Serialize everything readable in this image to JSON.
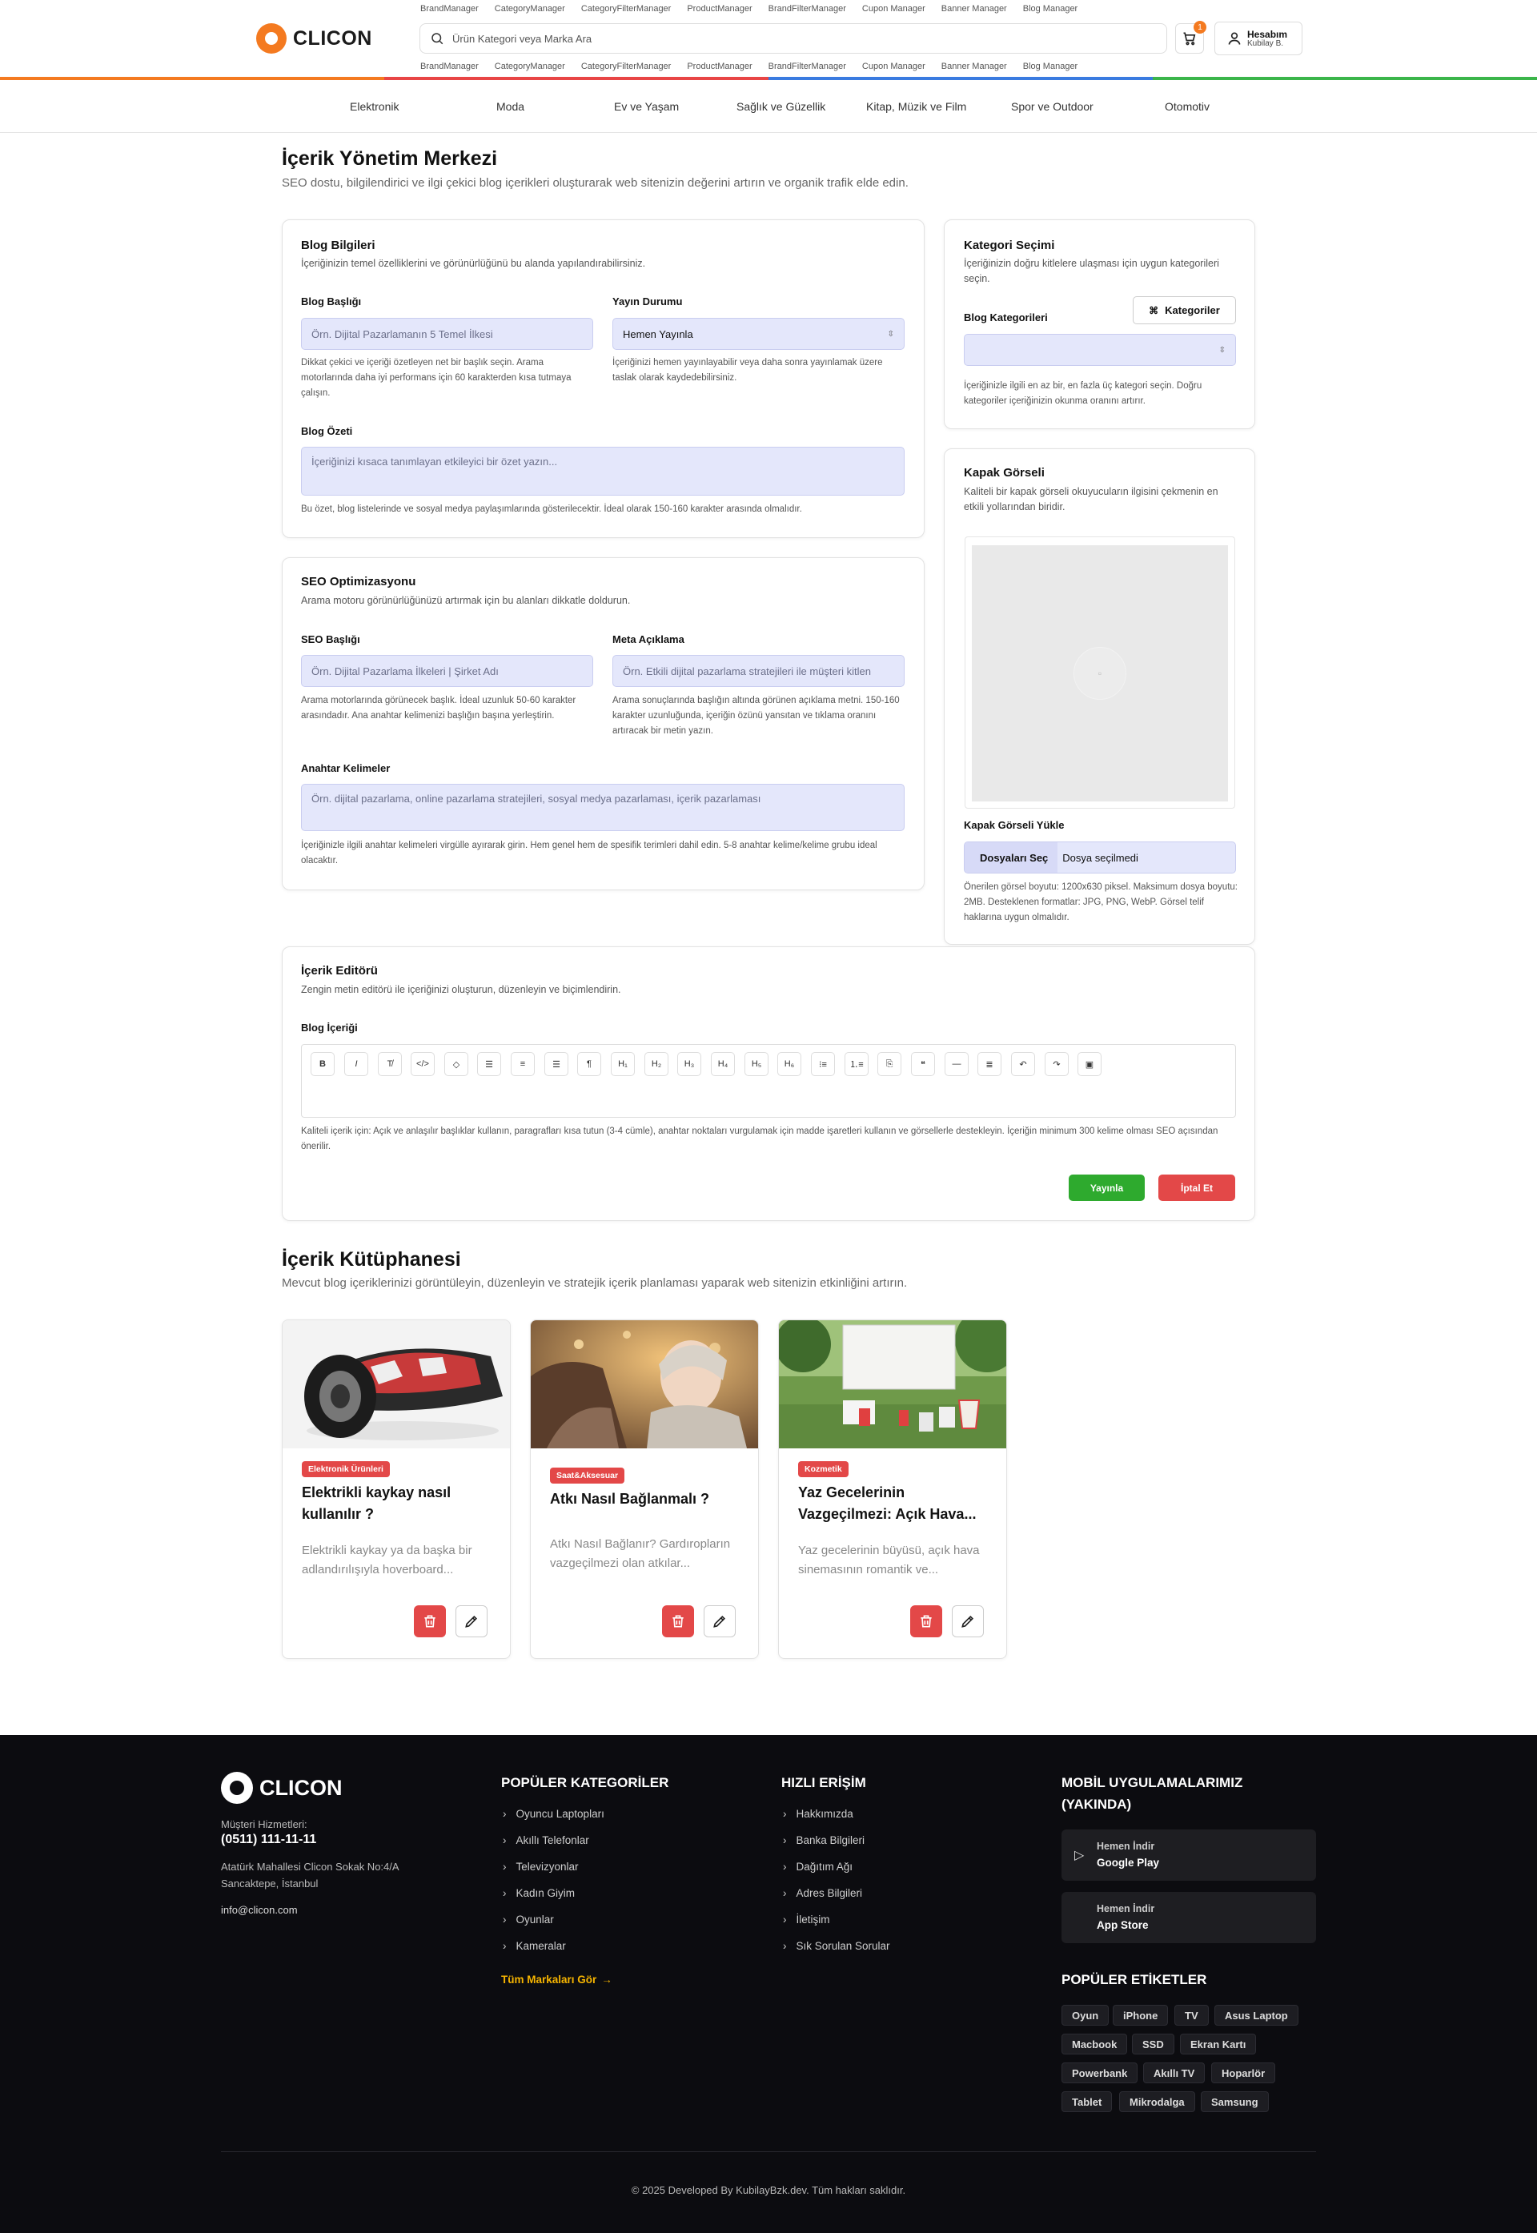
{
  "header": {
    "manager_links": [
      "BrandManager",
      "CategoryManager",
      "CategoryFilterManager",
      "ProductManager",
      "BrandFilterManager",
      "Cupon Manager",
      "Banner Manager",
      "Blog Manager"
    ],
    "logo": "CLICON",
    "search_placeholder": "Ürün Kategori veya Marka Ara",
    "cart_count": "1",
    "account_title": "Hesabım",
    "account_user": "Kubilay B."
  },
  "categories": [
    "Elektronik",
    "Moda",
    "Ev ve Yaşam",
    "Sağlık ve Güzellik",
    "Kitap, Müzik ve Film",
    "Spor ve Outdoor",
    "Otomotiv"
  ],
  "page": {
    "title": "İçerik Yönetim Merkezi",
    "subtitle": "SEO dostu, bilgilendirici ve ilgi çekici blog içerikleri oluşturarak web sitenizin değerini artırın ve organik trafik elde edin."
  },
  "blog_info": {
    "title": "Blog Bilgileri",
    "subtitle": "İçeriğinizin temel özelliklerini ve görünürlüğünü bu alanda yapılandırabilirsiniz.",
    "heading_label": "Blog Başlığı",
    "heading_placeholder": "Örn. Dijital Pazarlamanın 5 Temel İlkesi",
    "heading_hint": "Dikkat çekici ve içeriği özetleyen net bir başlık seçin. Arama motorlarında daha iyi performans için 60 karakterden kısa tutmaya çalışın.",
    "status_label": "Yayın Durumu",
    "status_value": "Hemen Yayınla",
    "status_hint": "İçeriğinizi hemen yayınlayabilir veya daha sonra yayınlamak üzere taslak olarak kaydedebilirsiniz.",
    "summary_label": "Blog Özeti",
    "summary_placeholder": "İçeriğinizi kısaca tanımlayan etkileyici bir özet yazın...",
    "summary_hint": "Bu özet, blog listelerinde ve sosyal medya paylaşımlarında gösterilecektir. İdeal olarak 150-160 karakter arasında olmalıdır."
  },
  "seo": {
    "title": "SEO Optimizasyonu",
    "subtitle": "Arama motoru görünürlüğünüzü artırmak için bu alanları dikkatle doldurun.",
    "seo_title_label": "SEO Başlığı",
    "seo_title_placeholder": "Örn. Dijital Pazarlama İlkeleri | Şirket Adı",
    "seo_title_hint": "Arama motorlarında görünecek başlık. İdeal uzunluk 50-60 karakter arasındadır. Ana anahtar kelimenizi başlığın başına yerleştirin.",
    "meta_label": "Meta Açıklama",
    "meta_placeholder": "Örn. Etkili dijital pazarlama stratejileri ile müşteri kitlen",
    "meta_hint": "Arama sonuçlarında başlığın altında görünen açıklama metni. 150-160 karakter uzunluğunda, içeriğin özünü yansıtan ve tıklama oranını artıracak bir metin yazın.",
    "keywords_label": "Anahtar Kelimeler",
    "keywords_placeholder": "Örn. dijital pazarlama, online pazarlama stratejileri, sosyal medya pazarlaması, içerik pazarlaması",
    "keywords_hint": "İçeriğinizle ilgili anahtar kelimeleri virgülle ayırarak girin. Hem genel hem de spesifik terimleri dahil edin. 5-8 anahtar kelime/kelime grubu ideal olacaktır."
  },
  "category": {
    "title": "Kategori Seçimi",
    "subtitle": "İçeriğinizin doğru kitlelere ulaşması için uygun kategorileri seçin.",
    "label": "Blog Kategorileri",
    "button": "Kategoriler",
    "hint": "İçeriğinizle ilgili en az bir, en fazla üç kategori seçin. Doğru kategoriler içeriğinizin okunma oranını artırır."
  },
  "cover": {
    "title": "Kapak Görseli",
    "subtitle": "Kaliteli bir kapak görseli okuyucuların ilgisini çekmenin en etkili yollarından biridir.",
    "upload_label": "Kapak Görseli Yükle",
    "choose_button": "Dosyaları Seç",
    "no_file": "Dosya seçilmedi",
    "hint": "Önerilen görsel boyutu: 1200x630 piksel. Maksimum dosya boyutu: 2MB. Desteklenen formatlar: JPG, PNG, WebP. Görsel telif haklarına uygun olmalıdır."
  },
  "editor": {
    "title": "İçerik Editörü",
    "subtitle": "Zengin metin editörü ile içeriğinizi oluşturun, düzenleyin ve biçimlendirin.",
    "label": "Blog İçeriği",
    "toolbar": [
      "bold-icon",
      "italic-icon",
      "clear-format-icon",
      "code-icon",
      "eraser-icon",
      "align-left-icon",
      "align-center-icon",
      "align-right-icon",
      "paragraph-icon",
      "h1-icon",
      "h2-icon",
      "h3-icon",
      "h4-icon",
      "h5-icon",
      "h6-icon",
      "bullet-list-icon",
      "ordered-list-icon",
      "code-block-icon",
      "quote-icon",
      "horizontal-rule-icon",
      "strikethrough-icon",
      "undo-icon",
      "redo-icon",
      "image-icon"
    ],
    "hint": "Kaliteli içerik için: Açık ve anlaşılır başlıklar kullanın, paragrafları kısa tutun (3-4 cümle), anahtar noktaları vurgulamak için madde işaretleri kullanın ve görsellerle destekleyin. İçeriğin minimum 300 kelime olması SEO açısından önerilir.",
    "publish": "Yayınla",
    "cancel": "İptal Et"
  },
  "library": {
    "title": "İçerik Kütüphanesi",
    "subtitle": "Mevcut blog içeriklerinizi görüntüleyin, düzenleyin ve stratejik içerik planlaması yaparak web sitenizin etkinliğini artırın.",
    "posts": [
      {
        "tag": "Elektronik Ürünleri",
        "title": "Elektrikli kaykay nasıl kullanılır ?",
        "excerpt": "Elektrikli kaykay ya da başka bir adlandırılışıyla hoverboard..."
      },
      {
        "tag": "Saat&Aksesuar",
        "title": "Atkı Nasıl Bağlanmalı ?",
        "excerpt": "Atkı Nasıl Bağlanır? Gardıropların vazgeçilmezi olan atkılar..."
      },
      {
        "tag": "Kozmetik",
        "title": "Yaz Gecelerinin Vazgeçilmezi: Açık Hava...",
        "excerpt": "Yaz gecelerinin büyüsü, açık hava sinemasının romantik ve..."
      }
    ]
  },
  "footer": {
    "logo": "CLICON",
    "support_label": "Müşteri Hizmetleri:",
    "phone": "(0511) 111-11-11",
    "address_1": "Atatürk Mahallesi Clicon Sokak No:4/A",
    "address_2": "Sancaktepe, İstanbul",
    "email": "info@clicon.com",
    "popular_title": "POPÜLER KATEGORİLER",
    "popular": [
      "Oyuncu Laptopları",
      "Akıllı Telefonlar",
      "Televizyonlar",
      "Kadın Giyim",
      "Oyunlar",
      "Kameralar"
    ],
    "all_brands": "Tüm Markaları Gör",
    "quick_title": "HIZLI ERİŞİM",
    "quick": [
      "Hakkımızda",
      "Banka Bilgileri",
      "Dağıtım Ağı",
      "Adres Bilgileri",
      "İletişim",
      "Sık Sorulan Sorular"
    ],
    "mobile_title_1": "MOBİL UYGULAMALARIMIZ",
    "mobile_title_2": "(YAKINDA)",
    "stores": [
      {
        "top": "Hemen İndir",
        "name": "Google Play"
      },
      {
        "top": "Hemen İndir",
        "name": "App Store"
      }
    ],
    "tags_title": "POPÜLER ETİKETLER",
    "tags": [
      "Oyun",
      "iPhone",
      "TV",
      "Asus Laptop",
      "Macbook",
      "SSD",
      "Ekran Kartı",
      "Powerbank",
      "Akıllı TV",
      "Hoparlör",
      "Tablet",
      "Mikrodalga",
      "Samsung"
    ],
    "copyright": "© 2025 Developed By KubilayBzk.dev. Tüm hakları saklıdır."
  },
  "colors": {
    "accent": "#f47a20",
    "publish": "#2eaa2e",
    "danger": "#e34848",
    "input_bg": "#e4e7fb",
    "footer_bg": "#0c0c10"
  }
}
